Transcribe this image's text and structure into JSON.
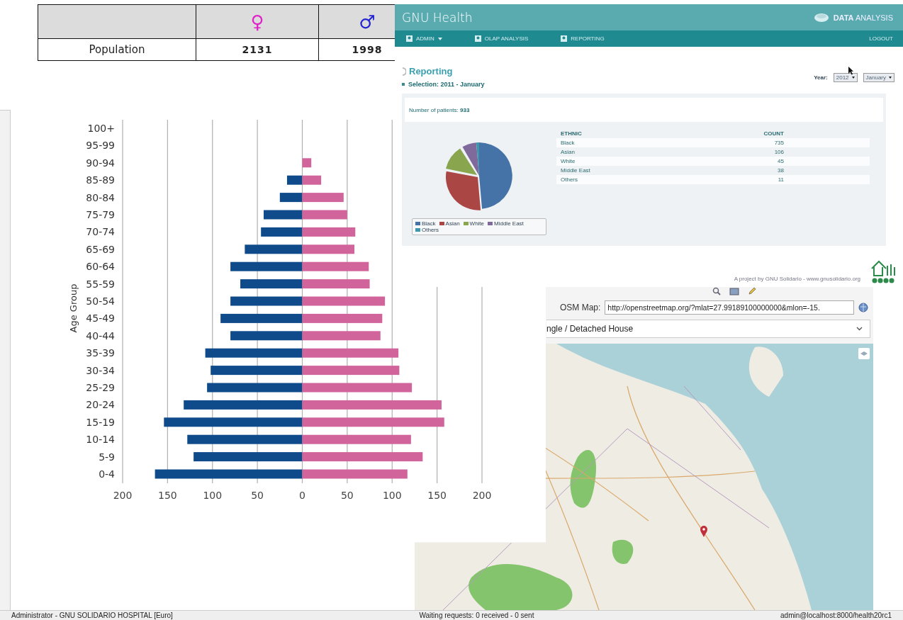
{
  "population_table": {
    "columns": [
      {
        "symbol": "♀",
        "color": "#e020c8"
      },
      {
        "symbol": "♂",
        "color": "#2424d0"
      }
    ],
    "rows": [
      {
        "label": "Population",
        "values": [
          "2131",
          "1998"
        ]
      }
    ]
  },
  "pyramid": {
    "chart_data": {
      "type": "bar",
      "orientation": "horizontal",
      "stacked": true,
      "ylabel": "Age Group",
      "categories": [
        "100+",
        "95-99",
        "90-94",
        "85-89",
        "80-84",
        "75-79",
        "70-74",
        "65-69",
        "60-64",
        "55-59",
        "50-54",
        "45-49",
        "40-44",
        "35-39",
        "30-34",
        "25-29",
        "20-24",
        "15-19",
        "10-14",
        "5-9",
        "0-4"
      ],
      "grid": true,
      "series": [
        {
          "color": "#0f4a8a",
          "values": [
            0,
            0,
            0,
            -17,
            -25,
            -43,
            -46,
            -64,
            -80,
            -69,
            -80,
            -91,
            -80,
            -108,
            -102,
            -106,
            -132,
            -154,
            -128,
            -121,
            -164
          ]
        },
        {
          "color": "#d2649c",
          "values": [
            0,
            0,
            10,
            21,
            46,
            50,
            59,
            58,
            74,
            75,
            92,
            89,
            87,
            107,
            108,
            122,
            155,
            158,
            121,
            134,
            117
          ]
        }
      ],
      "xlim": [
        -200,
        200
      ],
      "xticks": [
        {
          "value": -200,
          "label": "200"
        },
        {
          "value": -150,
          "label": "150"
        },
        {
          "value": -100,
          "label": "100"
        },
        {
          "value": -50,
          "label": "50"
        },
        {
          "value": 0,
          "label": "0"
        },
        {
          "value": 50,
          "label": "50"
        },
        {
          "value": 100,
          "label": "100"
        },
        {
          "value": 150,
          "label": "150"
        },
        {
          "value": 200,
          "label": "200"
        }
      ]
    }
  },
  "gnu_health": {
    "title": "GNU Health",
    "brand": "**DATA** ANALYSIS",
    "nav": [
      {
        "label": "ADMIN",
        "dropdown": true
      },
      {
        "label": "OLAP ANALYSIS",
        "dropdown": false
      },
      {
        "label": "REPORTING",
        "dropdown": false
      }
    ],
    "logout": "LOGOUT",
    "heading": "Reporting",
    "selection": "Selection: 2011 - January",
    "year_label": "Year:",
    "year": "2012",
    "month": "January",
    "patients": "Number of patients: **933**",
    "table": {
      "columns": [
        "ETHNIC",
        "COUNT"
      ],
      "rows": [
        [
          "Black",
          "735"
        ],
        [
          "Asian",
          "106"
        ],
        [
          "White",
          "45"
        ],
        [
          "Middle East",
          "38"
        ],
        [
          "Others",
          "11"
        ]
      ]
    },
    "legend": [
      {
        "label": "Black",
        "color": "#4572a7"
      },
      {
        "label": "Asian",
        "color": "#aa4643"
      },
      {
        "label": "White",
        "color": "#89a54e"
      },
      {
        "label": "Middle East",
        "color": "#80699b"
      },
      {
        "label": "Others",
        "color": "#3d96ae"
      }
    ],
    "footer": "A project by GNU Solidario - www.gnusolidario.org"
  },
  "patient_map": {
    "osm_label": "OSM Map:",
    "osm_url": "http://openstreetmap.org/?mlat=27.99189100000000&mlon=-15.",
    "housing": "ngle / Detached House"
  },
  "status_bar": {
    "left": "Administrator - GNU SOLIDARIO HOSPITAL [Euro]",
    "center": "Waiting requests: 0 received - 0 sent",
    "right": "admin@localhost:8000/health20rc1"
  }
}
